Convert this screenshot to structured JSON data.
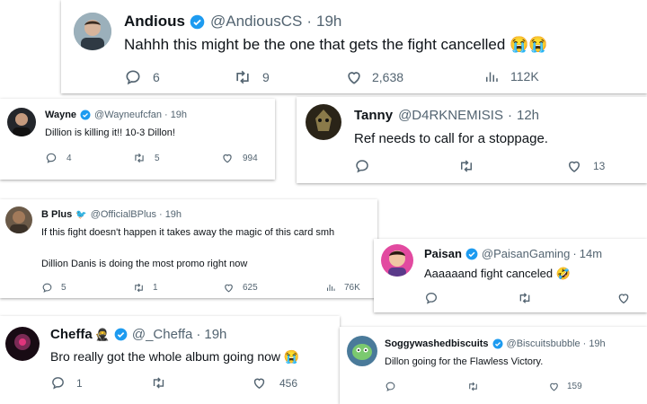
{
  "tweets": [
    {
      "name": "Andious",
      "handle": "@AndiousCS",
      "time": "19h",
      "verified": true,
      "text": "Nahhh this might be the one that gets the fight cancelled 😭😭",
      "replies": "6",
      "retweets": "9",
      "likes": "2,638",
      "views": "112K"
    },
    {
      "name": "Wayne",
      "handle": "@Wayneufcfan",
      "time": "19h",
      "verified": true,
      "text": "Dillion is killing it!! 10-3 Dillon!",
      "replies": "4",
      "retweets": "5",
      "likes": "994"
    },
    {
      "name": "Tanny",
      "handle": "@D4RKNEMISIS",
      "time": "12h",
      "verified": false,
      "text": "Ref needs to call for a stoppage.",
      "replies": "",
      "retweets": "",
      "likes": "13"
    },
    {
      "name": "B Plus",
      "name_emoji": "🐦",
      "handle": "@OfficialBPlus",
      "time": "19h",
      "verified": false,
      "text_lines": [
        "If this fight doesn't happen it takes away the magic of this card smh",
        "Dillion Danis is doing the most promo right now"
      ],
      "replies": "5",
      "retweets": "1",
      "likes": "625",
      "views": "76K"
    },
    {
      "name": "Paisan",
      "handle": "@PaisanGaming",
      "time": "14m",
      "verified": true,
      "text": "Aaaaaand fight canceled 🤣",
      "replies": "",
      "retweets": "",
      "likes": ""
    },
    {
      "name": "Cheffa",
      "name_emoji": "🥷",
      "handle": "@_Cheffa",
      "time": "19h",
      "verified": true,
      "text": "Bro really got the whole album going now 😭",
      "replies": "1",
      "retweets": "",
      "likes": "456"
    },
    {
      "name": "Soggywashedbiscuits",
      "handle": "@Biscuitsbubble",
      "time": "19h",
      "verified": true,
      "text": "Dillon going for the Flawless Victory.",
      "replies": "",
      "retweets": "",
      "likes": "159"
    }
  ],
  "sep": "·",
  "icons": {
    "reply": "reply-icon",
    "retweet": "retweet-icon",
    "like": "heart-icon",
    "views": "views-icon",
    "verified": "verified-badge-icon"
  },
  "colors": {
    "verified": "#1d9bf0",
    "text": "#0f1419",
    "muted": "#536471"
  }
}
